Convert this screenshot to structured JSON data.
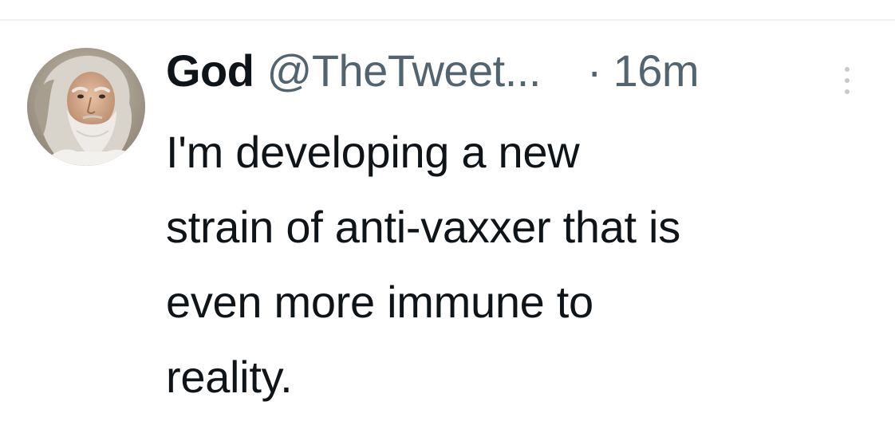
{
  "tweet": {
    "author": {
      "display_name": "God",
      "handle": "@TheTweet...",
      "avatar_icon": "god-portrait-avatar"
    },
    "separator": "·",
    "time_ago": "16m",
    "more_icon": "more-options-icon",
    "text_lines": [
      "I'm developing a new",
      "strain of anti-vaxxer that is",
      "even more immune to",
      "reality."
    ]
  },
  "colors": {
    "primary_text": "#0f1419",
    "secondary_text": "#536471",
    "divider": "#eff3f4"
  }
}
